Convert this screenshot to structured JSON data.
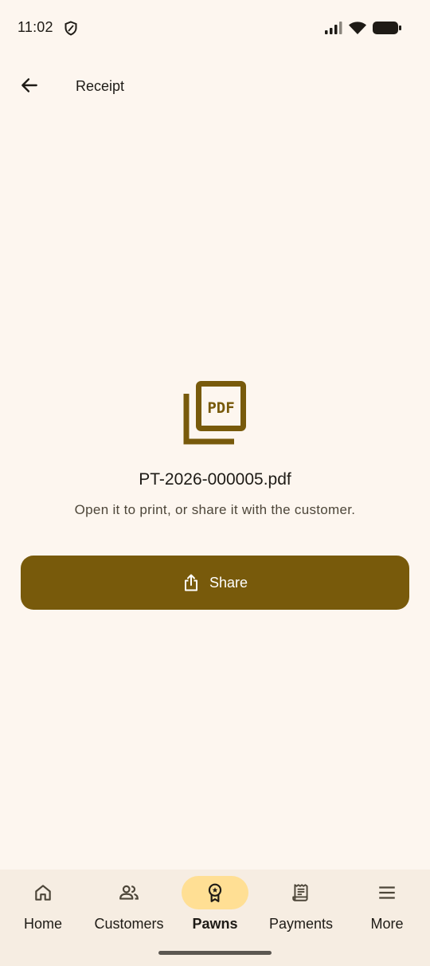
{
  "status_bar": {
    "time": "11:02"
  },
  "app_bar": {
    "title": "Receipt",
    "back_icon": "arrow-back-icon"
  },
  "content": {
    "file_icon": "pdf-file-icon",
    "pdf_badge": "PDF",
    "file_name": "PT-2026-000005.pdf",
    "hint": "Open it to print, or share it with the customer.",
    "share_label": "Share",
    "share_icon": "share-icon"
  },
  "bottom_nav": {
    "items": [
      {
        "label": "Home",
        "icon": "home-icon",
        "active": false
      },
      {
        "label": "Customers",
        "icon": "people-icon",
        "active": false
      },
      {
        "label": "Pawns",
        "icon": "award-badge-icon",
        "active": true
      },
      {
        "label": "Payments",
        "icon": "receipt-icon",
        "active": false
      },
      {
        "label": "More",
        "icon": "menu-icon",
        "active": false
      }
    ]
  },
  "colors": {
    "background": "#FDF6EF",
    "primary": "#785A0B",
    "nav_background": "#F6EDE2",
    "nav_active_pill": "#FFDF94",
    "text": "#1E1B16",
    "text_secondary": "#4D4639"
  }
}
